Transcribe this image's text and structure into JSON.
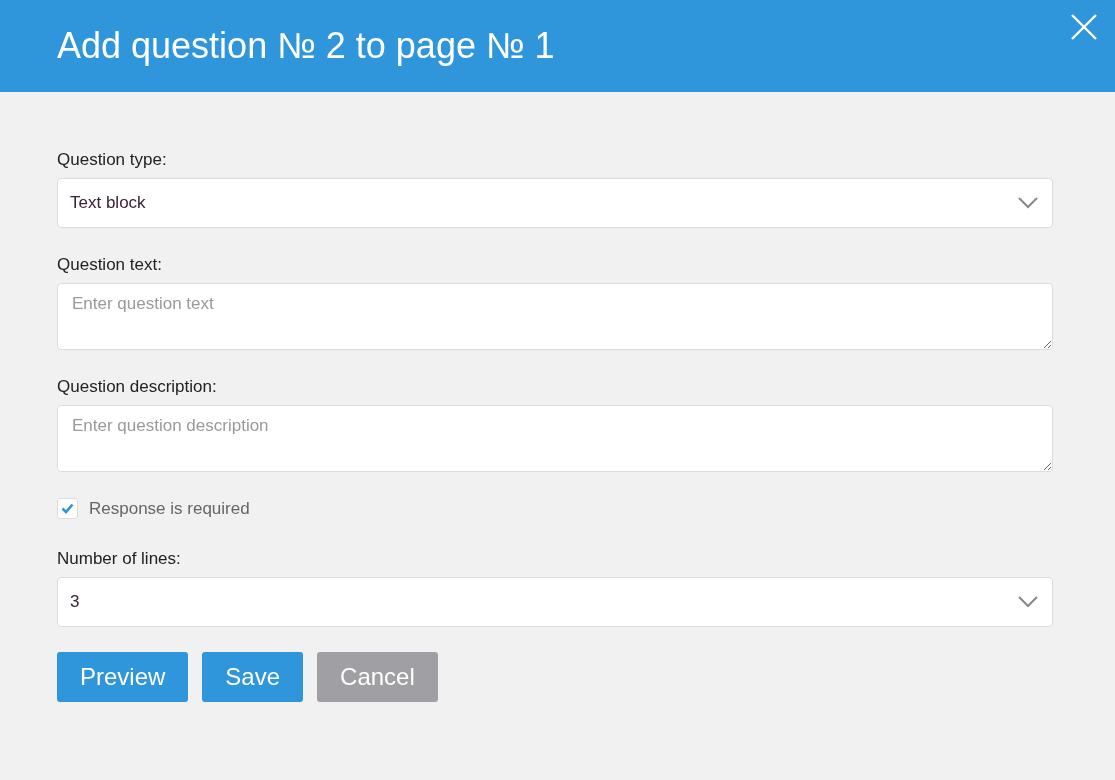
{
  "dialog": {
    "title": "Add question № 2 to page № 1"
  },
  "fields": [
    {
      "kind": "select",
      "label": "Question type:",
      "value": "Text block"
    },
    {
      "kind": "textarea",
      "label": "Question text:",
      "placeholder": "Enter question text"
    },
    {
      "kind": "textarea",
      "label": "Question description:",
      "placeholder": "Enter question description"
    },
    {
      "kind": "checkbox",
      "label": "Response is required",
      "checked": true
    },
    {
      "kind": "select",
      "label": "Number of lines:",
      "value": "3"
    }
  ],
  "buttons": [
    {
      "label": "Preview",
      "kind": "primary"
    },
    {
      "label": "Save",
      "kind": "primary"
    },
    {
      "label": "Cancel",
      "kind": "secondary"
    }
  ]
}
